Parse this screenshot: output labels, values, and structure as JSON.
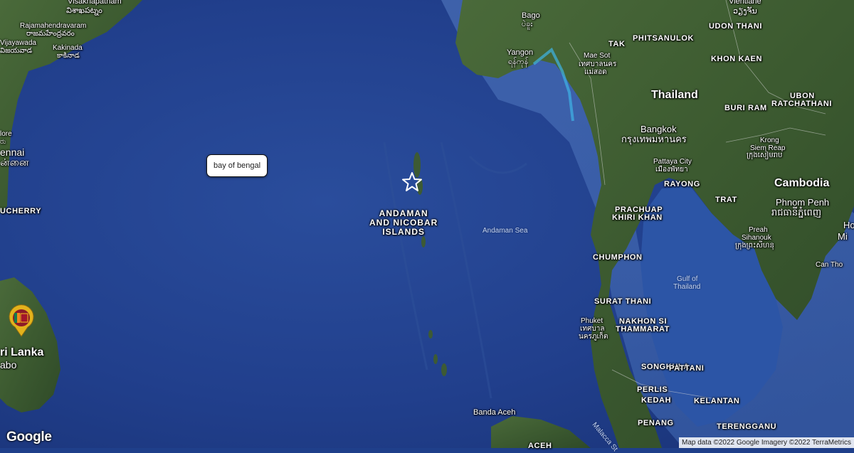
{
  "tooltip": {
    "text": "bay of bengal"
  },
  "logo": "Google",
  "attribution": "Map data ©2022 Google Imagery ©2022 TerraMetrics",
  "marker": {
    "icon": "star-icon"
  },
  "flag_pin": {
    "icon": "sri-lanka-flag-icon"
  },
  "labels": {
    "visakhapatnam": "Visakhapatnam",
    "visakhapatnam_te": "విశాఖపట్నం",
    "rajahmundry": "Rajamahendravaram",
    "rajahmundry_te": "రాజమహేంద్రవరం",
    "vijayawada": "Vijayawada",
    "vijayawada_te": "విజయవాడ",
    "kakinada": "Kakinada",
    "kakinada_te": "కాకినాడ",
    "bangalore_fragment": "lore",
    "bangalore_fragment_kn": "ರು",
    "chennai": "ennai",
    "chennai_ta": "ன்னை",
    "puducherry": "UCHERRY",
    "srilanka": "ri Lanka",
    "colombo": "abo",
    "andaman": [
      "ANDAMAN",
      "AND NICOBAR",
      "ISLANDS"
    ],
    "andaman_sea": "Andaman Sea",
    "bago": "Bago",
    "bago_my": "ပဲခူး",
    "yangon": "Yangon",
    "yangon_my": "ရန်ကုန်",
    "mae_sot": "Mae Sot",
    "mae_sot_th": [
      "เทศบาลนคร",
      "แม่สอด"
    ],
    "tak": "TAK",
    "phitsanulok": "PHITSANULOK",
    "vientiane": "Vientiane",
    "vientiane_lo": "ວຽງຈັນ",
    "udon_thani": "UDON THANI",
    "khon_kaen": "KHON KAEN",
    "thailand": "Thailand",
    "buri_ram": "BURI RAM",
    "ubon": "UBON",
    "ratchathani": "RATCHATHANI",
    "bangkok": "Bangkok",
    "bangkok_th": "กรุงเทพมหานคร",
    "pattaya": "Pattaya City",
    "pattaya_th": "เมืองพัทยา",
    "rayong": "RAYONG",
    "krong": "Krong",
    "siem_reap": "Siem Reap",
    "siem_reap_km": "ក្រុងសៀមរាប",
    "cambodia": "Cambodia",
    "phnom_penh": "Phnom Penh",
    "phnom_penh_km": "រាជធានីភ្នំពេញ",
    "ho_fragment": "Ho",
    "mi_fragment": "Mi",
    "trat": "TRAT",
    "prachuap": "PRACHUAP",
    "khiri_khan": "KHIRI KHAN",
    "preah": "Preah",
    "sihanouk": "Sihanouk",
    "sihanouk_km": "ក្រុងព្រះសីហនុ",
    "can_tho": "Can Tho",
    "chumphon": "CHUMPHON",
    "gulf_of": "Gulf of",
    "gulf_thailand": "Thailand",
    "surat_thani": "SURAT THANI",
    "phuket": "Phuket",
    "phuket_th": [
      "เทศบาล",
      "นครภูเก็ต"
    ],
    "nakhon_si": "NAKHON SI",
    "thammarat": "THAMMARAT",
    "songkhla": "SONGKHLA",
    "pattani": "PATTANI",
    "perlis": "PERLIS",
    "kedah": "KEDAH",
    "kelantan": "KELANTAN",
    "penang": "PENANG",
    "terengganu": "TERENGGANU",
    "banda_aceh": "Banda Aceh",
    "aceh": "ACEH",
    "malacca": "Malacca St"
  }
}
